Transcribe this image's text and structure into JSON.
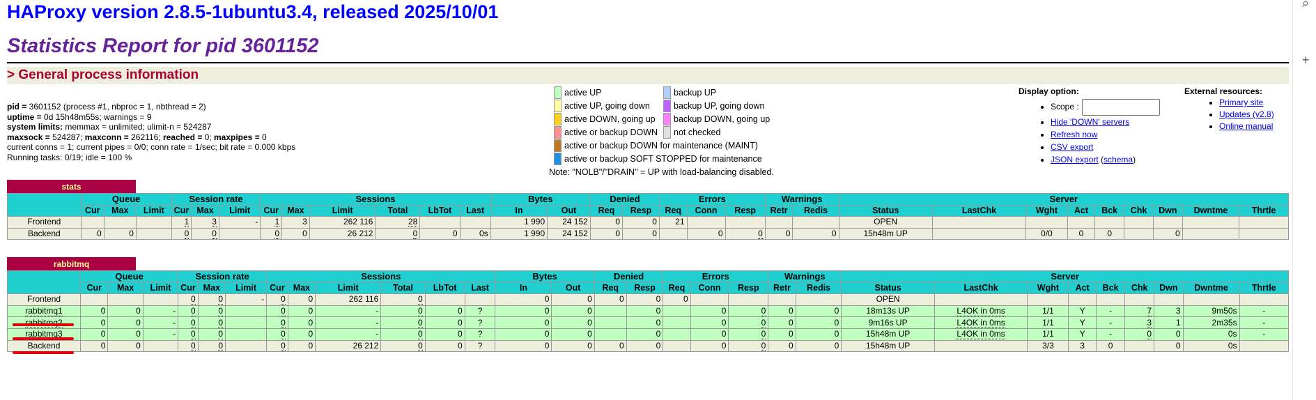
{
  "header": {
    "title": "HAProxy version 2.8.5-1ubuntu3.4, released 2025/10/01",
    "subtitle": "Statistics Report for pid 3601152"
  },
  "general_section": "> General process information",
  "process_info": [
    {
      "bold": "pid = ",
      "text": "3601152 (process #1, nbproc = 1, nbthread = 2)"
    },
    {
      "bold": "uptime = ",
      "text": "0d 15h48m55s; warnings = 9"
    },
    {
      "bold": "system limits:",
      "text": " memmax = unlimited; ulimit-n = 524287"
    },
    {
      "bold": "maxsock = ",
      "text": "524287; ",
      "bold2": "maxconn = ",
      "text2": "262116; ",
      "bold3": "reached = ",
      "text3": "0; ",
      "bold4": "maxpipes = ",
      "text4": "0"
    },
    {
      "bold": "",
      "text": "current conns = 1; current pipes = 0/0; conn rate = 1/sec; bit rate = 0.000 kbps"
    },
    {
      "bold": "",
      "text": "Running tasks: 0/19; idle = 100 %"
    }
  ],
  "legend": {
    "left": [
      {
        "label": "active UP",
        "color": "#c0ffc0"
      },
      {
        "label": "active UP, going down",
        "color": "#ffffa0"
      },
      {
        "label": "active DOWN, going up",
        "color": "#ffd020"
      },
      {
        "label": "active or backup DOWN",
        "color": "#ff9090"
      },
      {
        "label": "active or backup DOWN for maintenance (MAINT)",
        "color": "#c07820"
      },
      {
        "label": "active or backup SOFT STOPPED for maintenance",
        "color": "#2090e0"
      }
    ],
    "right": [
      {
        "label": "backup UP",
        "color": "#b0d0ff"
      },
      {
        "label": "backup UP, going down",
        "color": "#c060ff"
      },
      {
        "label": "backup DOWN, going up",
        "color": "#ff80ff"
      },
      {
        "label": "not checked",
        "color": "#e0e0e0"
      }
    ],
    "note": "Note: \"NOLB\"/\"DRAIN\" = UP with load-balancing disabled."
  },
  "display_options": {
    "title": "Display option:",
    "scope_label": "Scope :",
    "scope_value": "",
    "links": [
      "Hide 'DOWN' servers",
      "Refresh now",
      "CSV export",
      "JSON export"
    ],
    "schema_link": "schema",
    "schema_open": " (",
    "schema_close": ")"
  },
  "external_resources": {
    "title": "External resources:",
    "links": [
      "Primary site",
      "Updates (v2.8)",
      "Online manual"
    ]
  },
  "columns": {
    "groups": [
      "Queue",
      "Session rate",
      "Sessions",
      "Bytes",
      "Denied",
      "Errors",
      "Warnings",
      "Server"
    ],
    "sub": [
      "Cur",
      "Max",
      "Limit",
      "Cur",
      "Max",
      "Limit",
      "Cur",
      "Max",
      "Limit",
      "Total",
      "LbTot",
      "Last",
      "In",
      "Out",
      "Req",
      "Resp",
      "Req",
      "Conn",
      "Resp",
      "Retr",
      "Redis",
      "Status",
      "LastChk",
      "Wght",
      "Act",
      "Bck",
      "Chk",
      "Dwn",
      "Dwntme",
      "Thrtle"
    ]
  },
  "proxies": [
    {
      "name": "stats",
      "rows": [
        {
          "type": "frontend",
          "label": "Frontend",
          "cells": [
            "",
            "",
            "",
            "1",
            "3",
            "-",
            "1",
            "3",
            "262 116",
            "28",
            "",
            "",
            "1 990",
            "24 152",
            "0",
            "0",
            "21",
            "",
            "",
            "",
            "",
            "OPEN",
            "",
            "",
            "",
            "",
            "",
            "",
            "",
            ""
          ]
        },
        {
          "type": "backend",
          "label": "Backend",
          "cells": [
            "0",
            "0",
            "",
            "0",
            "0",
            "",
            "0",
            "0",
            "26 212",
            "0",
            "0",
            "0s",
            "1 990",
            "24 152",
            "0",
            "0",
            "",
            "0",
            "0",
            "0",
            "0",
            "15h48m UP",
            "",
            "0/0",
            "0",
            "0",
            "",
            "0",
            "",
            ""
          ]
        }
      ]
    },
    {
      "name": "rabbitmq",
      "rows": [
        {
          "type": "frontend",
          "label": "Frontend",
          "cells": [
            "",
            "",
            "",
            "0",
            "0",
            "-",
            "0",
            "0",
            "262 116",
            "0",
            "",
            "",
            "0",
            "0",
            "0",
            "0",
            "0",
            "",
            "",
            "",
            "",
            "OPEN",
            "",
            "",
            "",
            "",
            "",
            "",
            "",
            ""
          ]
        },
        {
          "type": "srv",
          "label": "rabbitmq1",
          "cells": [
            "0",
            "0",
            "-",
            "0",
            "0",
            "",
            "0",
            "0",
            "-",
            "0",
            "0",
            "?",
            "0",
            "0",
            "",
            "0",
            "",
            "0",
            "0",
            "0",
            "0",
            "18m13s UP",
            "L4OK in 0ms",
            "1/1",
            "Y",
            "-",
            "7",
            "3",
            "9m50s",
            "-"
          ]
        },
        {
          "type": "srv",
          "label": "rabbitmq2",
          "cells": [
            "0",
            "0",
            "-",
            "0",
            "0",
            "",
            "0",
            "0",
            "-",
            "0",
            "0",
            "?",
            "0",
            "0",
            "",
            "0",
            "",
            "0",
            "0",
            "0",
            "0",
            "9m16s UP",
            "L4OK in 0ms",
            "1/1",
            "Y",
            "-",
            "3",
            "1",
            "2m35s",
            "-"
          ]
        },
        {
          "type": "srv",
          "label": "rabbitmq3",
          "cells": [
            "0",
            "0",
            "-",
            "0",
            "0",
            "",
            "0",
            "0",
            "-",
            "0",
            "0",
            "?",
            "0",
            "0",
            "",
            "0",
            "",
            "0",
            "0",
            "0",
            "0",
            "15h48m UP",
            "L4OK in 0ms",
            "1/1",
            "Y",
            "-",
            "0",
            "0",
            "0s",
            "-"
          ]
        },
        {
          "type": "backend",
          "label": "Backend",
          "cells": [
            "0",
            "0",
            "",
            "0",
            "0",
            "",
            "0",
            "0",
            "26 212",
            "0",
            "0",
            "?",
            "0",
            "0",
            "0",
            "0",
            "",
            "0",
            "0",
            "0",
            "0",
            "15h48m UP",
            "",
            "3/3",
            "3",
            "0",
            "",
            "0",
            "0s",
            ""
          ]
        }
      ]
    }
  ],
  "browser_sidebar": {
    "icons": [
      "search-icon",
      "plus-icon"
    ],
    "glyphs": [
      "⌕",
      "+"
    ]
  }
}
